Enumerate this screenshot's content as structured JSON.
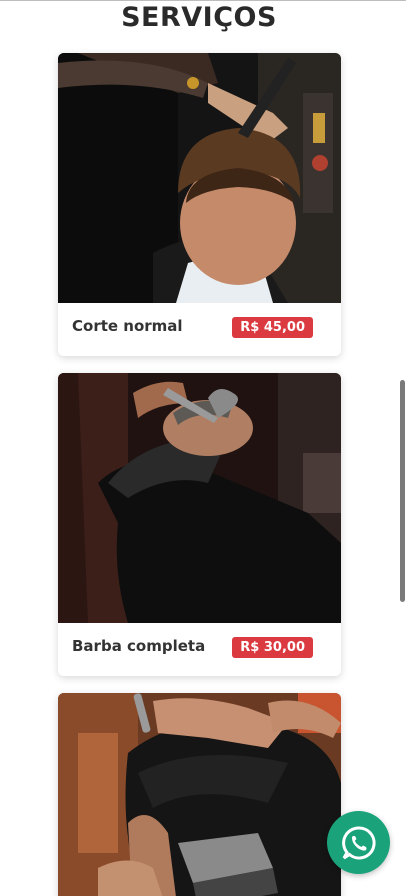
{
  "page": {
    "title": "SERVIÇOS"
  },
  "services": [
    {
      "name": "Corte normal",
      "price": "R$ 45,00"
    },
    {
      "name": "Barba completa",
      "price": "R$ 30,00"
    },
    {
      "name": "",
      "price": ""
    }
  ],
  "colors": {
    "price_badge": "#db3b40",
    "whatsapp": "#1aa37a"
  },
  "icons": {
    "floating_action": "whatsapp-icon"
  }
}
